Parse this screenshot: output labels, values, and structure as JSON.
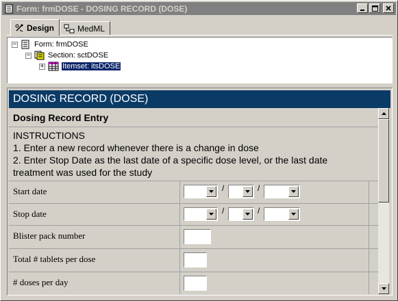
{
  "window": {
    "title": "Form: frmDOSE - DOSING RECORD (DOSE)"
  },
  "tabs": [
    {
      "label": "Design",
      "active": true,
      "icon": "design-icon"
    },
    {
      "label": "MedML",
      "active": false,
      "icon": "medml-icon"
    }
  ],
  "tree": {
    "form": {
      "label": "Form: frmDOSE",
      "expander": "−"
    },
    "section": {
      "label": "Section: sctDOSE",
      "expander": "−"
    },
    "itemset": {
      "label": "Itemset: itsDOSE",
      "expander": "+",
      "selected": true
    }
  },
  "form": {
    "header": "DOSING RECORD (DOSE)",
    "section_title": "Dosing Record Entry",
    "instructions": [
      "INSTRUCTIONS",
      "1. Enter a new record whenever there is a change in dose",
      "2. Enter Stop Date as the last date of a specific dose level, or the last date treatment was used for the study"
    ],
    "date_separator": "/",
    "fields": [
      {
        "label": "Start date",
        "type": "date"
      },
      {
        "label": "Stop date",
        "type": "date"
      },
      {
        "label": "Blister pack number",
        "type": "text"
      },
      {
        "label": "Total # tablets per dose",
        "type": "text"
      },
      {
        "label": "# doses per day",
        "type": "text"
      }
    ]
  },
  "colors": {
    "header_bg": "#0a3a66",
    "selection_bg": "#0a246a",
    "titlebar_inactive": "#808080"
  }
}
